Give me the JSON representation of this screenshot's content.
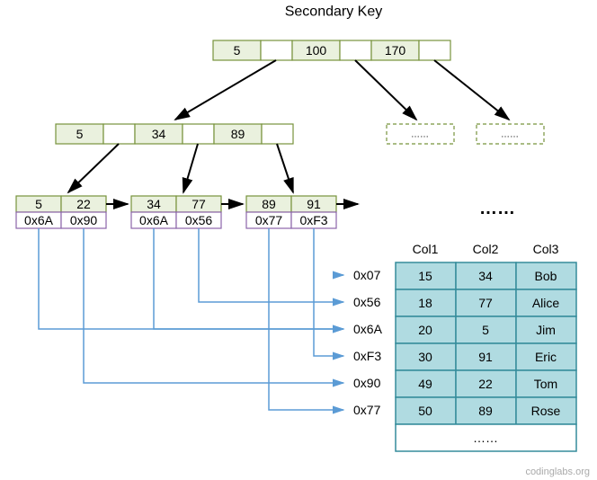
{
  "title": "Secondary Key",
  "root": {
    "keys": [
      "5",
      "100",
      "170"
    ]
  },
  "mid": {
    "keys": [
      "5",
      "34",
      "89"
    ]
  },
  "leaves": [
    {
      "keys": [
        "5",
        "22"
      ],
      "ptrs": [
        "0x6A",
        "0x90"
      ]
    },
    {
      "keys": [
        "34",
        "77"
      ],
      "ptrs": [
        "0x6A",
        "0x56"
      ]
    },
    {
      "keys": [
        "89",
        "91"
      ],
      "ptrs": [
        "0x77",
        "0xF3"
      ]
    }
  ],
  "ellipsis_big": "……",
  "ellipsis_small": "……",
  "addrs": [
    "0x07",
    "0x56",
    "0x6A",
    "0xF3",
    "0x90",
    "0x77"
  ],
  "table": {
    "headers": [
      "Col1",
      "Col2",
      "Col3"
    ],
    "rows": [
      [
        "15",
        "34",
        "Bob"
      ],
      [
        "18",
        "77",
        "Alice"
      ],
      [
        "20",
        "5",
        "Jim"
      ],
      [
        "30",
        "91",
        "Eric"
      ],
      [
        "49",
        "22",
        "Tom"
      ],
      [
        "50",
        "89",
        "Rose"
      ]
    ],
    "footer": "……"
  },
  "watermark": "codinglabs.org"
}
